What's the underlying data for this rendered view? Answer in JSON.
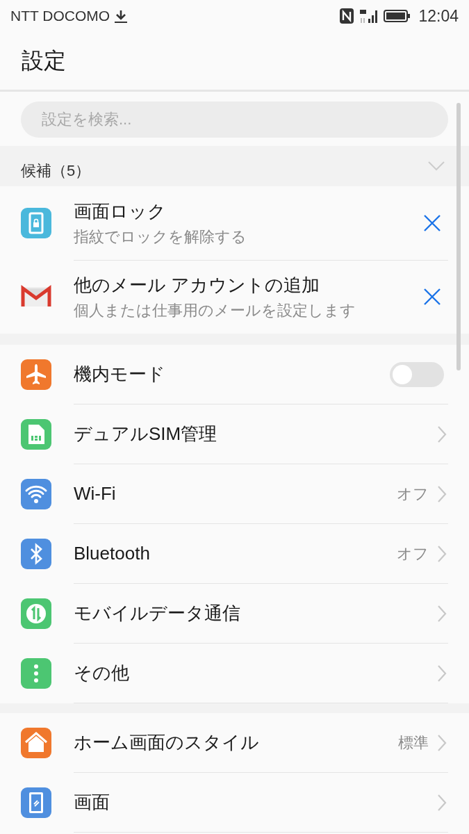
{
  "status_bar": {
    "carrier": "NTT DOCOMO",
    "time": "12:04"
  },
  "header": {
    "title": "設定"
  },
  "search": {
    "placeholder": "設定を検索..."
  },
  "suggestions": {
    "label": "候補（5）",
    "expanded": false,
    "items": [
      {
        "title": "画面ロック",
        "subtitle": "指紋でロックを解除する"
      },
      {
        "title": "他のメール アカウントの追加",
        "subtitle": "個人または仕事用のメールを設定します"
      }
    ]
  },
  "groups": [
    [
      {
        "kind": "toggle",
        "label": "機内モード",
        "on": false
      },
      {
        "kind": "link",
        "label": "デュアルSIM管理"
      },
      {
        "kind": "link",
        "label": "Wi-Fi",
        "value": "オフ"
      },
      {
        "kind": "link",
        "label": "Bluetooth",
        "value": "オフ"
      },
      {
        "kind": "link",
        "label": "モバイルデータ通信"
      },
      {
        "kind": "link",
        "label": "その他"
      }
    ],
    [
      {
        "kind": "link",
        "label": "ホーム画面のスタイル",
        "value": "標準"
      },
      {
        "kind": "link",
        "label": "画面"
      }
    ]
  ]
}
